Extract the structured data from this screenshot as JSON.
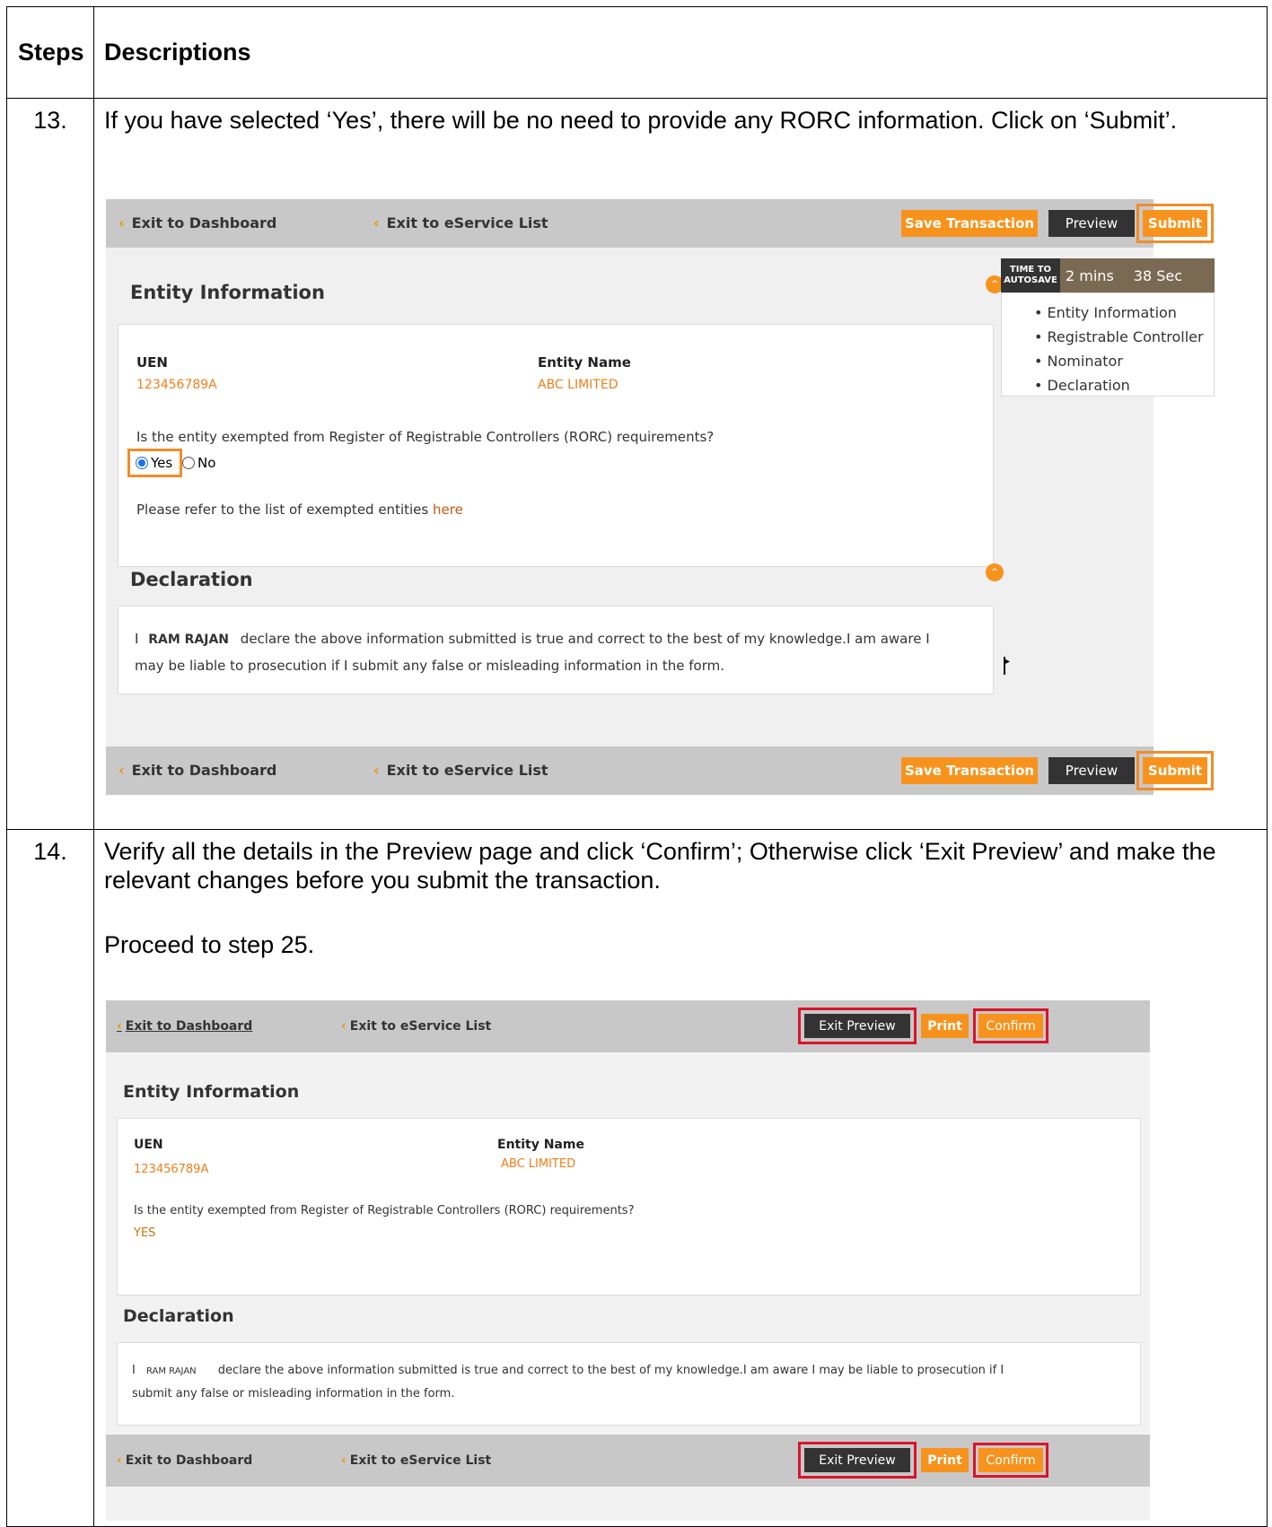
{
  "table": {
    "header_steps": "Steps",
    "header_descriptions": "Descriptions"
  },
  "step13": {
    "number": "13.",
    "text": "If you have selected ‘Yes’, there will be no need to provide any RORC information. Click on ‘Submit’.",
    "ui": {
      "exit_dashboard": "Exit to Dashboard",
      "exit_eservice": "Exit to eService List",
      "save_transaction": "Save Transaction",
      "preview": "Preview",
      "submit": "Submit",
      "entity_info_title": "Entity Information",
      "autosave_label_1": "TIME TO",
      "autosave_label_2": "AUTOSAVE",
      "autosave_mins": "2 mins",
      "autosave_sec": "38 Sec",
      "nav_items": [
        "Entity Information",
        "Registrable Controller",
        "Nominator",
        "Declaration"
      ],
      "uen_label": "UEN",
      "uen_value": "123456789A",
      "entity_name_label": "Entity Name",
      "entity_name_value": "ABC LIMITED",
      "question": "Is the entity exempted from Register of Registrable Controllers (RORC) requirements?",
      "yes": "Yes",
      "no": "No",
      "refer_text": "Please refer to the list of exempted entities",
      "here": "here",
      "declaration_title": "Declaration",
      "decl_i": "I",
      "decl_name": "RAM RAJAN",
      "decl_line1": "declare the above information submitted is true and correct to the best of my knowledge.I am aware I",
      "decl_line2": "may be liable to prosecution if I submit any false or misleading information in the form."
    }
  },
  "step14": {
    "number": "14.",
    "text": "Verify all the details in the Preview page and click ‘Confirm’; Otherwise click ‘Exit Preview’ and make the relevant changes before you submit the transaction.",
    "text2": "Proceed to step 25.",
    "ui": {
      "exit_dashboard": "Exit to Dashboard",
      "exit_eservice": "Exit to eService List",
      "exit_preview": "Exit Preview",
      "print": "Print",
      "confirm": "Confirm",
      "entity_info_title": "Entity Information",
      "uen_label": "UEN",
      "uen_value": "123456789A",
      "entity_name_label": "Entity Name",
      "entity_name_value": "ABC LIMITED",
      "question": "Is the entity exempted from Register of Registrable Controllers (RORC) requirements?",
      "answer": "YES",
      "declaration_title": "Declaration",
      "decl_i": "I",
      "decl_name": "RAM RAJAN",
      "decl_line1": "declare the above information submitted is true and correct to the best of my knowledge.I am aware I may be liable to prosecution if I",
      "decl_line2": "submit any false or misleading information in the form."
    }
  }
}
